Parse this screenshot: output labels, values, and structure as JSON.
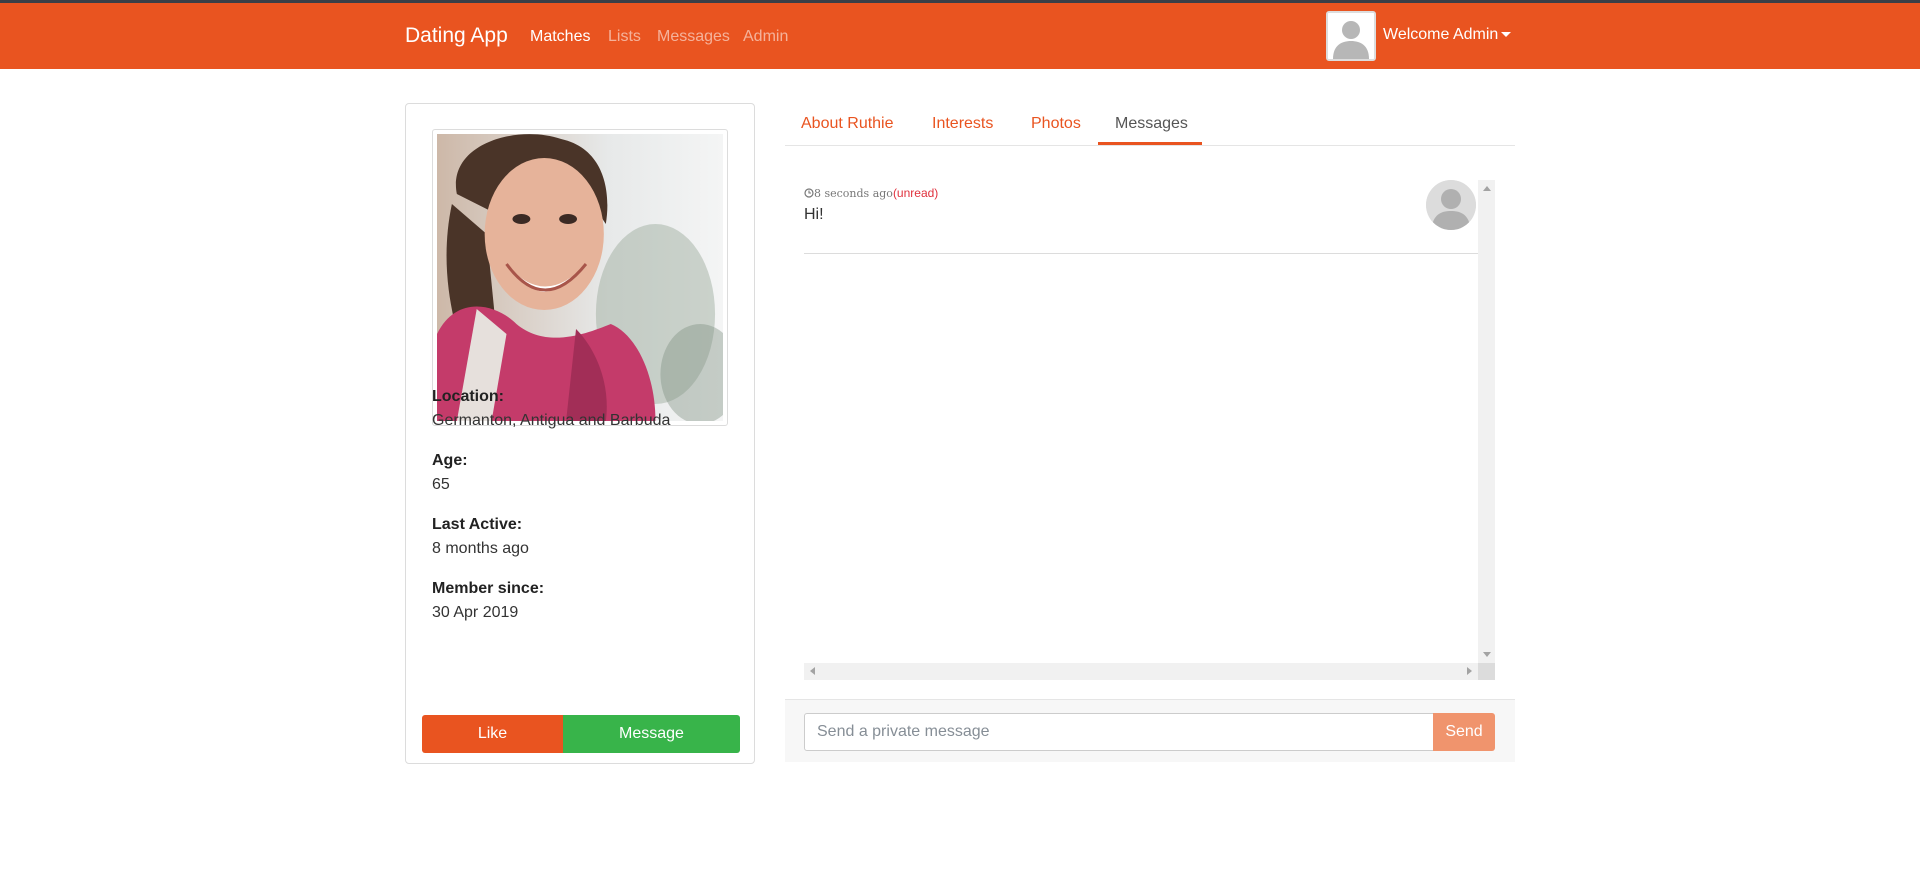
{
  "colors": {
    "brand": "#e95420",
    "success": "#38b44a",
    "unread": "#e0313d",
    "send_disabled": "#f0946d"
  },
  "navbar": {
    "brand": "Dating App",
    "links": [
      {
        "label": "Matches",
        "active": true
      },
      {
        "label": "Lists",
        "active": false
      },
      {
        "label": "Messages",
        "active": false
      },
      {
        "label": "Admin",
        "active": false
      }
    ],
    "welcome": "Welcome Admin",
    "avatar_icon": "user-placeholder-icon"
  },
  "profile": {
    "photo_alt": "Ruthie",
    "location_label": "Location:",
    "location": "Germanton, Antigua and Barbuda",
    "age_label": "Age:",
    "age": "65",
    "last_active_label": "Last Active:",
    "last_active": "8 months ago",
    "member_since_label": "Member since:",
    "member_since": "30 Apr 2019",
    "like_label": "Like",
    "message_label": "Message"
  },
  "tabs": [
    {
      "label": "About Ruthie",
      "active": false
    },
    {
      "label": "Interests",
      "active": false
    },
    {
      "label": "Photos",
      "active": false
    },
    {
      "label": "Messages",
      "active": true
    }
  ],
  "messages": [
    {
      "time": "8 seconds ago",
      "status": "(unread)",
      "text": "Hi!",
      "avatar_icon": "user-placeholder-icon"
    }
  ],
  "composer": {
    "placeholder": "Send a private message",
    "value": "",
    "send_label": "Send"
  }
}
